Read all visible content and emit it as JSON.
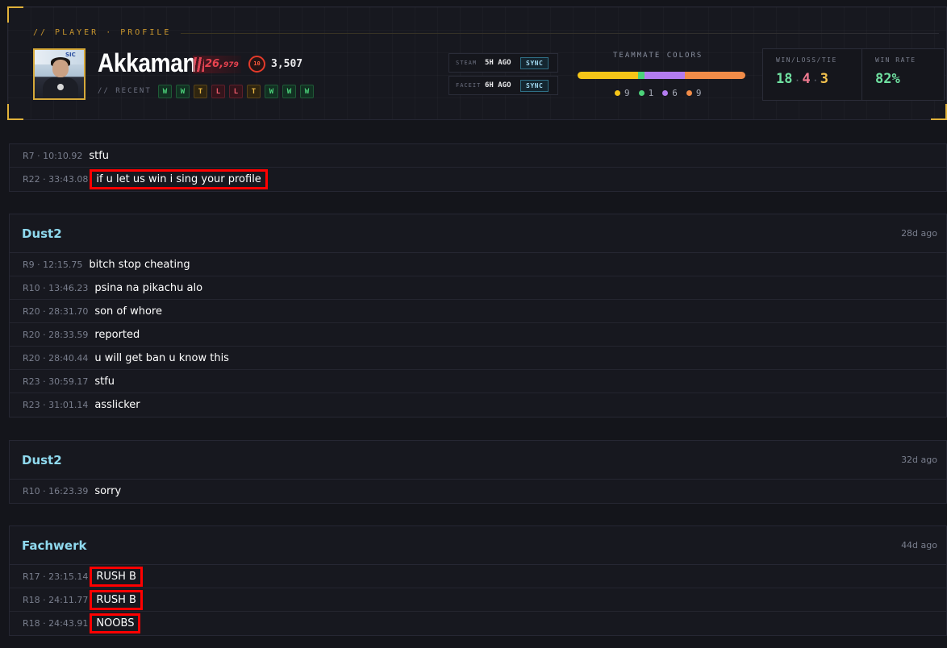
{
  "profile": {
    "eyebrow": "// PLAYER · PROFILE",
    "name": "Akkaman",
    "premier_rating": "26,",
    "premier_rating_small": "979",
    "faceit_level": "10",
    "faceit_elo": "3,507",
    "recent_label": "// RECENT",
    "recent": [
      "W",
      "W",
      "T",
      "L",
      "L",
      "T",
      "W",
      "W",
      "W"
    ],
    "sync": [
      {
        "source": "STEAM",
        "ago": "5H AGO",
        "button": "SYNC"
      },
      {
        "source": "FACEIT",
        "ago": "6H AGO",
        "button": "SYNC"
      }
    ],
    "teammate_colors": {
      "label": "TEAMMATE COLORS",
      "items": [
        {
          "count": "9",
          "color": "#f5c518"
        },
        {
          "count": "1",
          "color": "#4cd27a"
        },
        {
          "count": "6",
          "color": "#b37cf0"
        },
        {
          "count": "9",
          "color": "#f28c48"
        }
      ]
    },
    "wlt_label": "WIN/LOSS/TIE",
    "wins": "18",
    "losses": "4",
    "ties": "3",
    "sep": "·",
    "winrate_label": "WIN RATE",
    "winrate": "82%"
  },
  "cards": [
    {
      "map": "",
      "age": "",
      "messages": [
        {
          "ts": "R7 · 10:10.92",
          "text": "stfu",
          "highlighted": false
        },
        {
          "ts": "R22 · 33:43.08",
          "text": "if u let us win i sing your profile",
          "highlighted": true
        }
      ]
    },
    {
      "map": "Dust2",
      "age": "28d ago",
      "messages": [
        {
          "ts": "R9 · 12:15.75",
          "text": "bitch stop cheating",
          "highlighted": false
        },
        {
          "ts": "R10 · 13:46.23",
          "text": "psina na pikachu alo",
          "highlighted": false
        },
        {
          "ts": "R20 · 28:31.70",
          "text": "son of whore",
          "highlighted": false
        },
        {
          "ts": "R20 · 28:33.59",
          "text": "reported",
          "highlighted": false
        },
        {
          "ts": "R20 · 28:40.44",
          "text": "u will get ban u know this",
          "highlighted": false
        },
        {
          "ts": "R23 · 30:59.17",
          "text": "stfu",
          "highlighted": false
        },
        {
          "ts": "R23 · 31:01.14",
          "text": "asslicker",
          "highlighted": false
        }
      ]
    },
    {
      "map": "Dust2",
      "age": "32d ago",
      "messages": [
        {
          "ts": "R10 · 16:23.39",
          "text": "sorry",
          "highlighted": false
        }
      ]
    },
    {
      "map": "Fachwerk",
      "age": "44d ago",
      "messages": [
        {
          "ts": "R17 · 23:15.14",
          "text": "RUSH B",
          "highlighted": true
        },
        {
          "ts": "R18 · 24:11.77",
          "text": "RUSH B",
          "highlighted": true
        },
        {
          "ts": "R18 · 24:43.91",
          "text": "NOOBS",
          "highlighted": true
        }
      ]
    }
  ]
}
